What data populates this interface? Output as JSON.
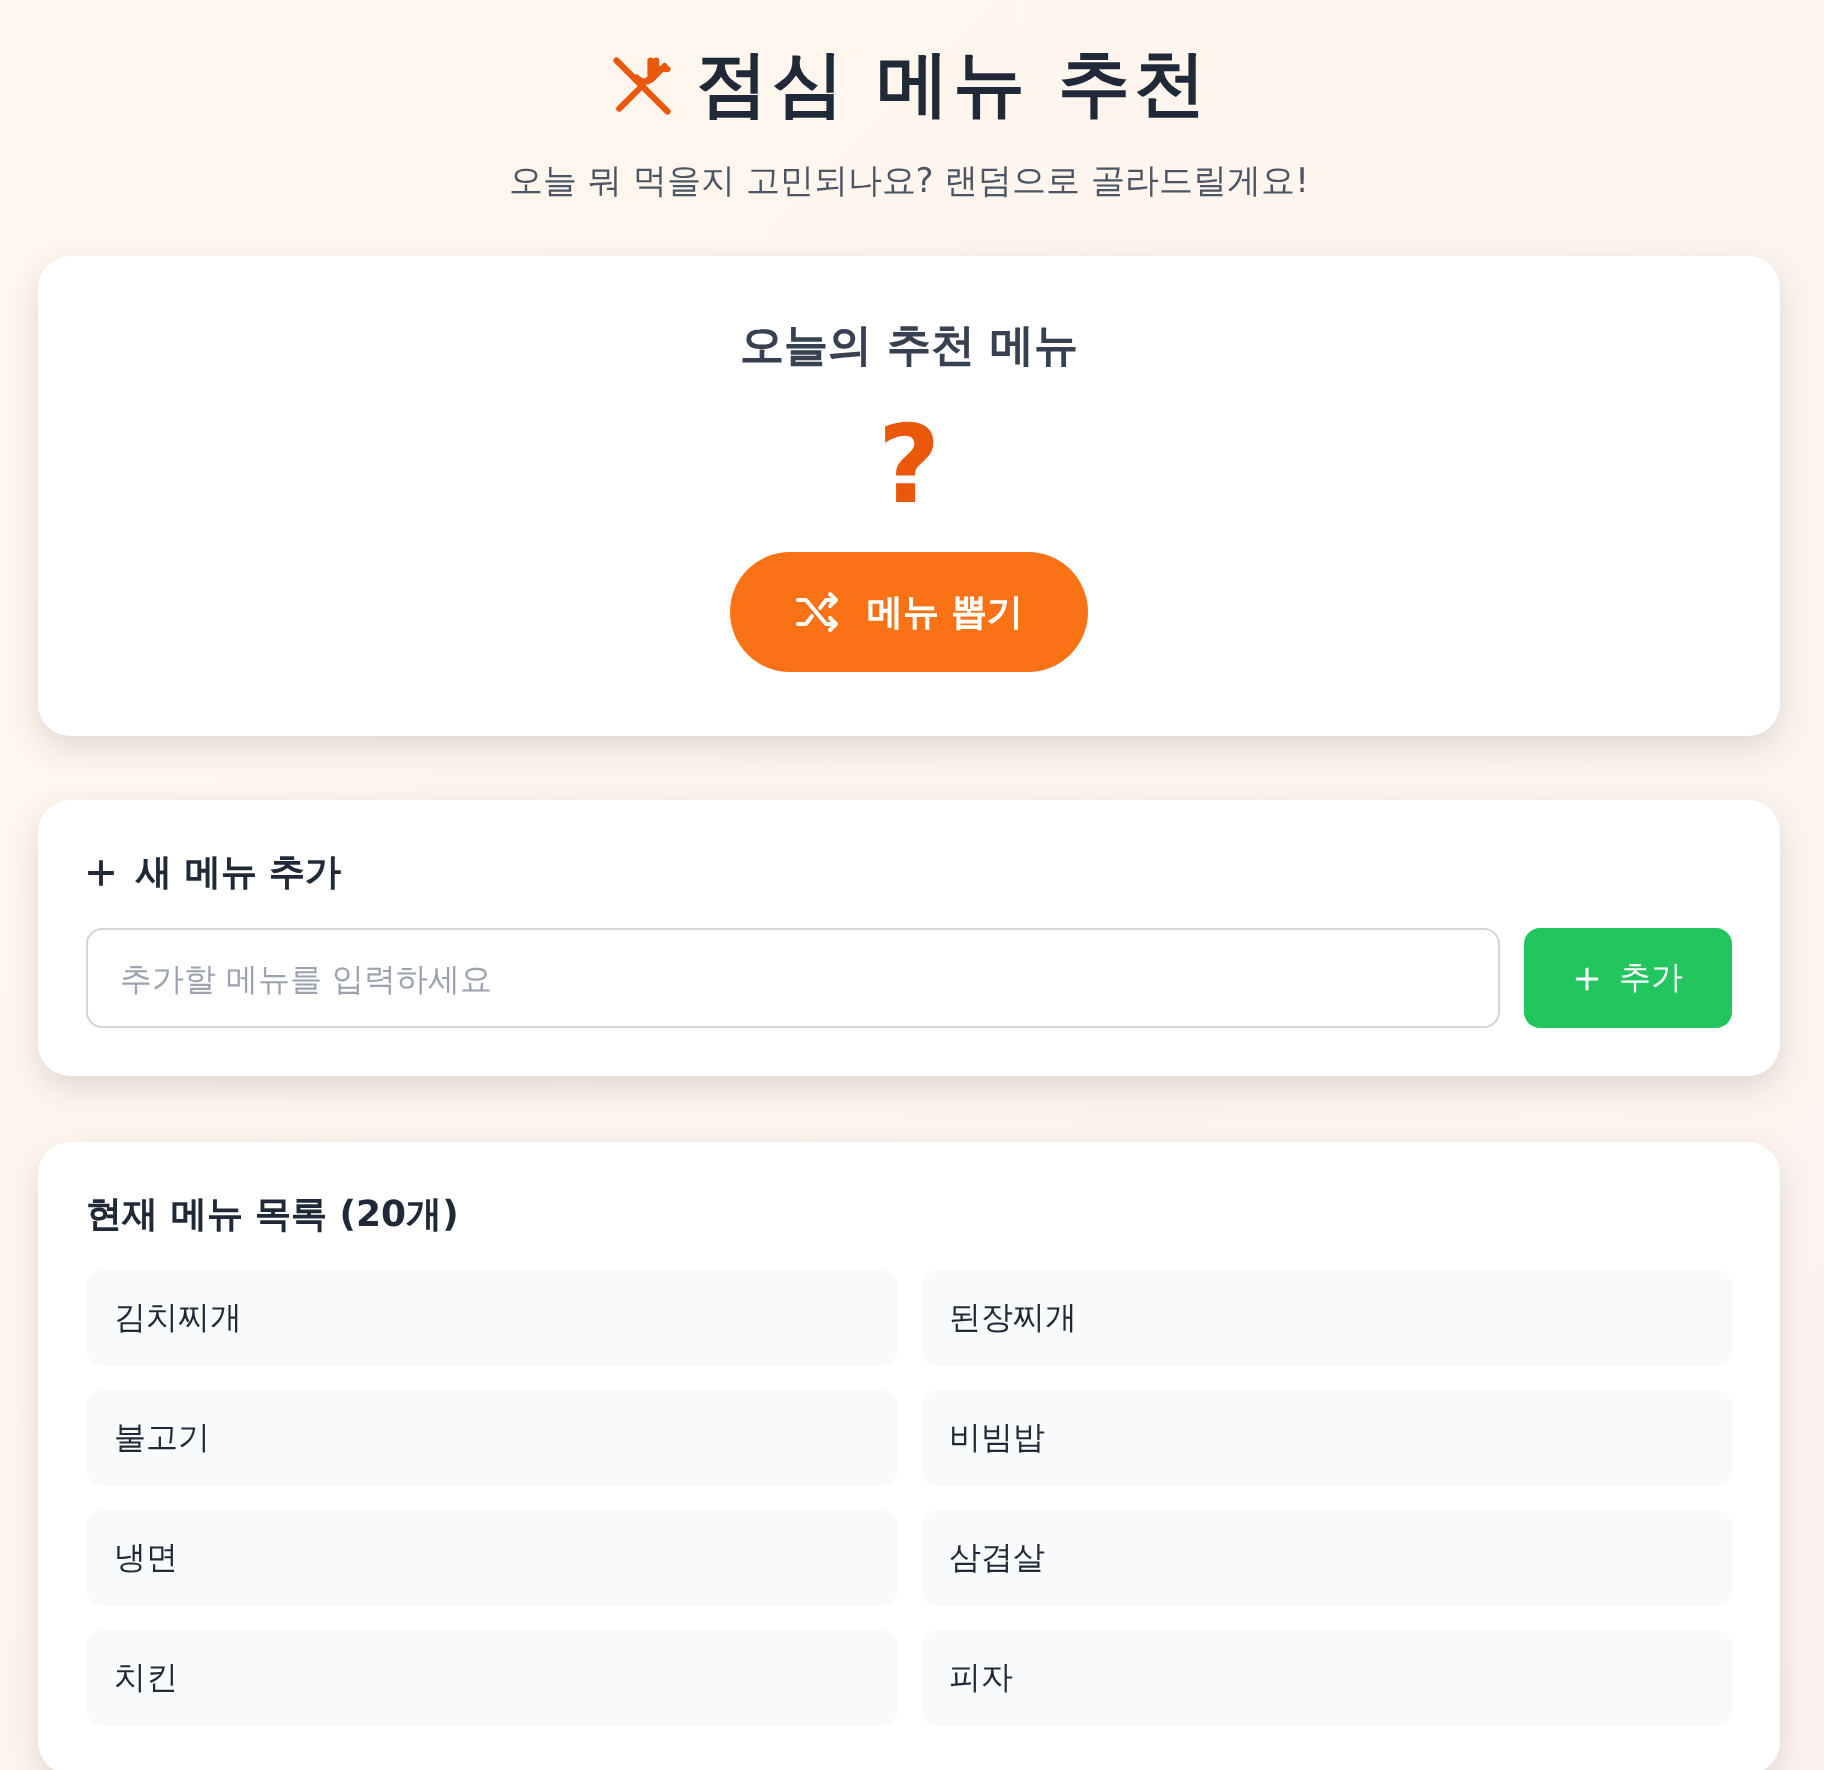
{
  "header": {
    "title": "점심 메뉴 추천",
    "subtitle": "오늘 뭐 먹을지 고민되나요? 랜덤으로 골라드릴게요!"
  },
  "result": {
    "heading": "오늘의 추천 메뉴",
    "value": "?",
    "button": "메뉴 뽑기"
  },
  "add_form": {
    "heading": "새 메뉴 추가",
    "placeholder": "추가할 메뉴를 입력하세요",
    "button": "추가"
  },
  "menu_list": {
    "heading": "현재 메뉴 목록 (20개)",
    "items": [
      {
        "name": "김치찌개"
      },
      {
        "name": "된장찌개"
      },
      {
        "name": "불고기"
      },
      {
        "name": "비빔밥"
      },
      {
        "name": "냉면"
      },
      {
        "name": "삼겹살"
      },
      {
        "name": "치킨"
      },
      {
        "name": "피자"
      }
    ]
  }
}
